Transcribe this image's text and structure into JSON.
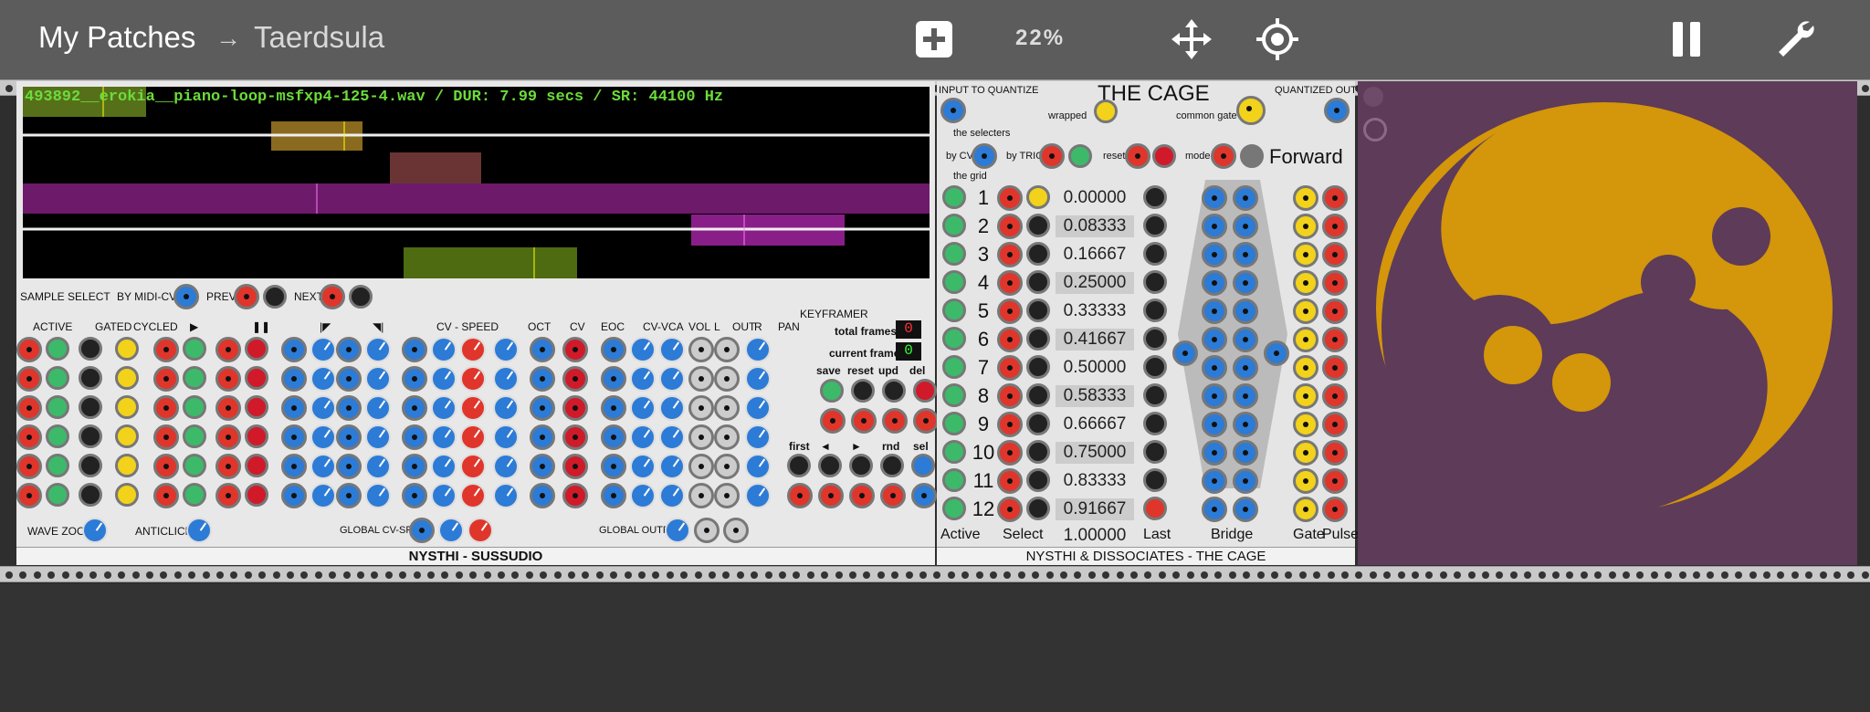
{
  "header": {
    "breadcrumb_main": "My Patches",
    "breadcrumb_arrow": "→",
    "breadcrumb_sub": "Taerdsula",
    "zoom": "22%",
    "icons": [
      "add-icon",
      "move-icon",
      "target-icon",
      "pause-icon",
      "wrench-icon"
    ]
  },
  "sussudio": {
    "file_info": "493892__erokia__piano-loop-msfxp4-125-4.wav / DUR: 7.99 secs / SR: 44100 Hz",
    "sample_select": "SAMPLE SELECT",
    "by_midi": "BY MIDI-CV",
    "prev": "PREV",
    "next": "NEXT",
    "col_labels": [
      "ACTIVE",
      "GATED",
      "CYCLED",
      "▶",
      "❚❚",
      "|◤",
      "◥|",
      "CV - SPEED",
      "OCT",
      "CV",
      "EOC",
      "CV-VCA",
      "VOL",
      "L",
      "OUT",
      "R",
      "PAN"
    ],
    "keyframer": "KEYFRAMER",
    "total_frames": "total frames",
    "total_frames_val": "0",
    "current_frame": "current frame",
    "current_frame_val": "0",
    "kf_buttons": [
      "save",
      "reset",
      "upd",
      "del"
    ],
    "kf_nav": [
      "first",
      "◄",
      "►",
      "rnd",
      "sel"
    ],
    "wave_zoom": "WAVE ZOOM",
    "anticlick": "ANTICLICK",
    "global_cv_speed": "GLOBAL CV-SPEED",
    "global_outputs": "GLOBAL OUTPUTS",
    "footer": "NYSTHI - SUSSUDIO"
  },
  "cage": {
    "input_label": "INPUT TO QUANTIZE",
    "title": "THE CAGE",
    "quantized": "QUANTIZED OUTPUT",
    "wrapped": "wrapped",
    "common_gate": "common gate",
    "selecters": "the selecters",
    "by_cv": "by CV",
    "by_trig": "by TRIG",
    "reset": "reset",
    "mode": "mode",
    "mode_value": "Forward",
    "grid": "the grid",
    "rows": [
      "1",
      "2",
      "3",
      "4",
      "5",
      "6",
      "7",
      "8",
      "9",
      "10",
      "11",
      "12"
    ],
    "values": [
      "0.00000",
      "0.08333",
      "0.16667",
      "0.25000",
      "0.33333",
      "0.41667",
      "0.50000",
      "0.58333",
      "0.66667",
      "0.75000",
      "0.83333",
      "0.91667"
    ],
    "range_value": "1.00000",
    "col_footer": [
      "Active",
      "Select",
      "Last",
      "Bridge",
      "Gate",
      "Pulse"
    ],
    "footer": "NYSTHI & DISSOCIATES - THE CAGE"
  },
  "colors": {
    "accent_blue": "#2c7bd6",
    "red": "#e0352b",
    "green": "#3cba6a",
    "yellow": "#f2d21a",
    "gold": "#d4960a",
    "purple": "#5e3b58"
  }
}
